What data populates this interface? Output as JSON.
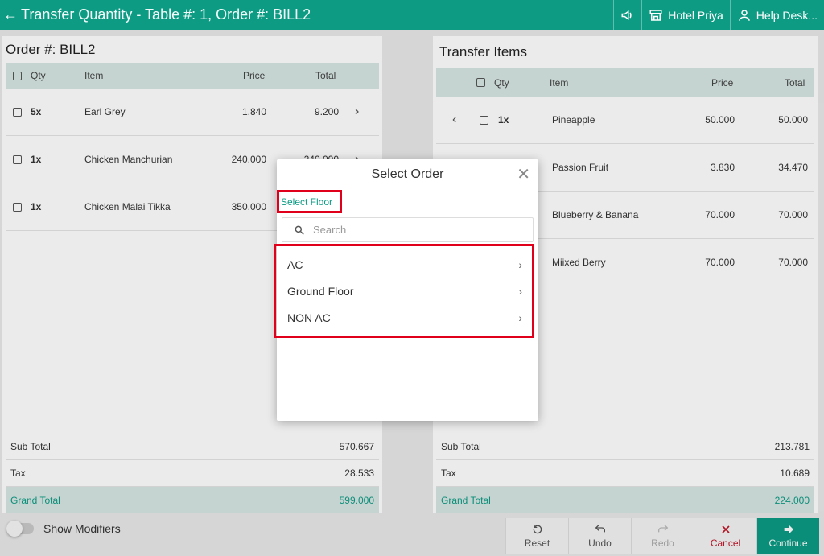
{
  "header": {
    "title": "Transfer Quantity - Table #: 1, Order #: BILL2",
    "outlet": "Hotel Priya",
    "help": "Help Desk..."
  },
  "left": {
    "title": "Order #: BILL2",
    "columns": {
      "qty": "Qty",
      "item": "Item",
      "price": "Price",
      "total": "Total"
    },
    "rows": [
      {
        "qty": "5x",
        "item": "Earl Grey",
        "price": "1.840",
        "total": "9.200"
      },
      {
        "qty": "1x",
        "item": "Chicken Manchurian",
        "price": "240.000",
        "total": "240.000"
      },
      {
        "qty": "1x",
        "item": "Chicken Malai Tikka",
        "price": "350.000",
        "total": ""
      }
    ],
    "totals": {
      "sub_label": "Sub Total",
      "sub": "570.667",
      "tax_label": "Tax",
      "tax": "28.533",
      "grand_label": "Grand Total",
      "grand": "599.000"
    }
  },
  "right": {
    "title": "Transfer Items",
    "columns": {
      "qty": "Qty",
      "item": "Item",
      "price": "Price",
      "total": "Total"
    },
    "rows": [
      {
        "qty": "1x",
        "item": "Pineapple",
        "price": "50.000",
        "total": "50.000"
      },
      {
        "qty": "",
        "item": "Passion Fruit",
        "price": "3.830",
        "total": "34.470"
      },
      {
        "qty": "",
        "item": "Blueberry & Banana",
        "price": "70.000",
        "total": "70.000"
      },
      {
        "qty": "",
        "item": "Miixed Berry",
        "price": "70.000",
        "total": "70.000"
      }
    ],
    "totals": {
      "sub_label": "Sub Total",
      "sub": "213.781",
      "tax_label": "Tax",
      "tax": "10.689",
      "grand_label": "Grand Total",
      "grand": "224.000"
    }
  },
  "modal": {
    "title": "Select Order",
    "floor_link": "Select Floor",
    "search_placeholder": "Search",
    "floors": [
      "AC",
      "Ground Floor",
      "NON AC"
    ]
  },
  "footer": {
    "show_modifiers": "Show Modifiers",
    "reset": "Reset",
    "undo": "Undo",
    "redo": "Redo",
    "cancel": "Cancel",
    "continue": "Continue"
  },
  "colors": {
    "accent": "#0d9b84",
    "highlight": "#e0001b",
    "cancel": "#c0182c"
  }
}
